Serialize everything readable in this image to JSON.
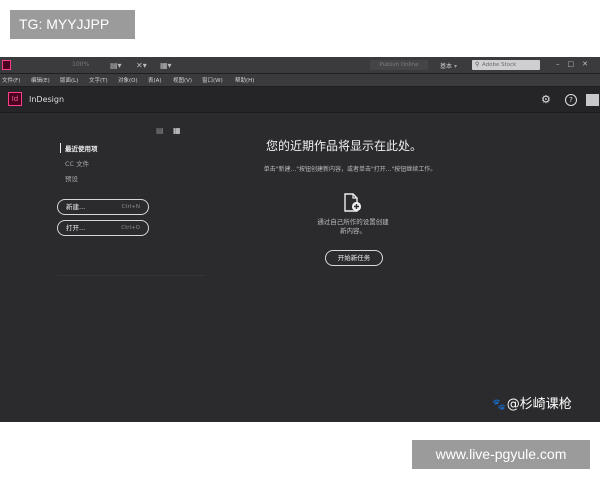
{
  "overlay": {
    "tg_label": "TG: MYYJJPP",
    "url_label": "www.live-pgyule.com"
  },
  "appbar": {
    "zoom": "100%",
    "publish_online": "Publish Online",
    "workspace": "基本",
    "search_placeholder": "Adobe Stock"
  },
  "menu": {
    "items": [
      "文件(F)",
      "编辑(E)",
      "版面(L)",
      "文字(T)",
      "对象(O)",
      "表(A)",
      "视图(V)",
      "窗口(W)",
      "帮助(H)"
    ]
  },
  "titlebar": {
    "logo": "Id",
    "app_name": "InDesign"
  },
  "left_nav": {
    "recent": "最近使用项",
    "cc_files": "CC 文件",
    "presets": "预设"
  },
  "buttons": {
    "new_label": "新建...",
    "new_shortcut": "Ctrl+N",
    "open_label": "打开...",
    "open_shortcut": "Ctrl+O",
    "start_label": "开始新任务"
  },
  "main": {
    "title": "您的近期作品将显示在此处。",
    "subtitle": "单击\"新建...\"按钮创建新内容，或者单击\"打开...\"按钮继续工作。",
    "create_line1": "通过自己所作的设置创建",
    "create_line2": "新内容。"
  },
  "watermark": {
    "text": "@杉崎课枪"
  },
  "colors": {
    "app_bg": "#2b2a2c",
    "titlebar_bg": "#252426",
    "accent_pink": "#ff3d8b"
  }
}
